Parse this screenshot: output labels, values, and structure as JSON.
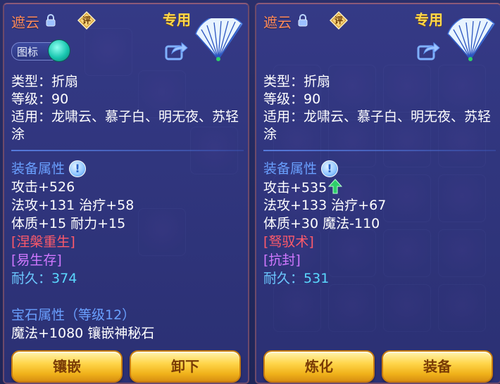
{
  "left": {
    "name": "遮云",
    "eval_badge": "评",
    "special": "专用",
    "toggle_label": "图标",
    "type_line": "类型：折扇",
    "level_line": "等级：90",
    "use_line": "适用：龙啸云、慕子白、明无夜、苏轻涂",
    "attr_title": "装备属性",
    "attack": "攻击+526",
    "stats2": "法攻+131 治疗+58",
    "stats3": "体质+15 耐力+15",
    "skill1": "[涅槃重生]",
    "skill2": "[易生存]",
    "durability_label": "耐久：",
    "durability_value": "374",
    "gem_title": "宝石属性（等级12）",
    "gem_detail": "魔法+1080 镶嵌神秘石",
    "btn1": "镶嵌",
    "btn2": "卸下"
  },
  "right": {
    "name": "遮云",
    "eval_badge": "评",
    "special": "专用",
    "type_line": "类型：折扇",
    "level_line": "等级：90",
    "use_line": "适用：龙啸云、慕子白、明无夜、苏轻涂",
    "attr_title": "装备属性",
    "attack": "攻击+535",
    "stats2": "法攻+133 治疗+67",
    "stats3": "体质+30 魔法-110",
    "skill1": "[驽驭术]",
    "skill2": "[抗封]",
    "durability_label": "耐久：",
    "durability_value": "531",
    "btn1": "炼化",
    "btn2": "装备"
  },
  "icons": {
    "lock": "lock-icon",
    "eval": "evaluate-badge-icon",
    "fan": "folding-fan-item-icon",
    "share": "share-icon",
    "info": "info-exclamation-icon",
    "up": "stat-up-arrow-icon"
  },
  "colors": {
    "name": "#ff8a5a",
    "special": "#ffd84a",
    "section": "#6aa0ff",
    "skill_red": "#ff5a6a",
    "skill_pink": "#d078ff",
    "durability": "#5ad8ff",
    "button": "#ffd54a",
    "up_arrow": "#2ecf6a"
  }
}
